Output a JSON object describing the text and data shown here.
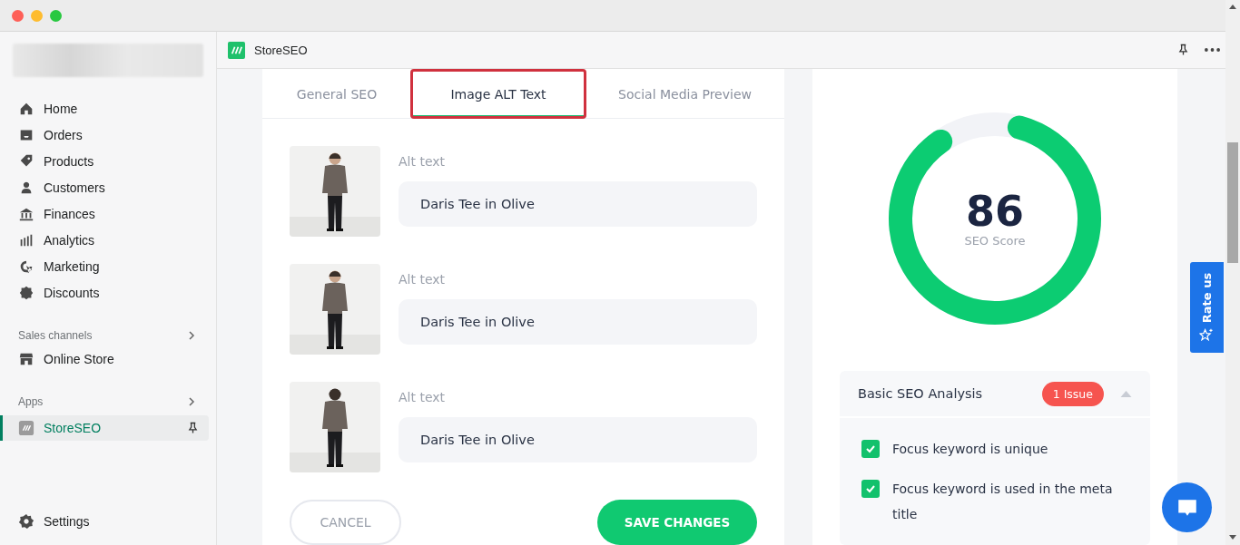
{
  "sidebar": {
    "items": [
      {
        "label": "Home",
        "selected": false
      },
      {
        "label": "Orders",
        "selected": false
      },
      {
        "label": "Products",
        "selected": false
      },
      {
        "label": "Customers",
        "selected": false
      },
      {
        "label": "Finances",
        "selected": false
      },
      {
        "label": "Analytics",
        "selected": false
      },
      {
        "label": "Marketing",
        "selected": false
      },
      {
        "label": "Discounts",
        "selected": false
      }
    ],
    "sales_channels": {
      "heading": "Sales channels",
      "items": [
        {
          "label": "Online Store",
          "selected": false
        }
      ]
    },
    "apps": {
      "heading": "Apps",
      "items": [
        {
          "label": "StoreSEO",
          "selected": true
        }
      ]
    },
    "settings": "Settings"
  },
  "app_header": {
    "title": "StoreSEO"
  },
  "tabs": [
    {
      "label": "General SEO",
      "selected": false,
      "highlighted": false
    },
    {
      "label": "Image ALT Text",
      "selected": true,
      "highlighted": true
    },
    {
      "label": "Social Media Preview",
      "selected": false,
      "highlighted": false
    }
  ],
  "images": [
    {
      "label": "Alt text",
      "value": "Daris Tee in Olive",
      "kind": "picture"
    },
    {
      "label": "Alt text",
      "value": "Daris Tee in Olive",
      "kind": "picture"
    },
    {
      "label": "Alt text",
      "value": "Daris Tee in Olive",
      "kind": "picture"
    }
  ],
  "buttons": {
    "cancel": "CANCEL",
    "save": "SAVE CHANGES"
  },
  "score": {
    "value": "86",
    "label": "SEO Score",
    "level": 0.86
  },
  "analysis": {
    "title": "Basic SEO Analysis",
    "badge": "1 Issue",
    "expanded": true,
    "items": [
      {
        "label": "Focus keyword is unique",
        "checked": true
      },
      {
        "label": "Focus keyword is used in the meta title",
        "checked": true
      }
    ]
  },
  "rate_us": "Rate us"
}
